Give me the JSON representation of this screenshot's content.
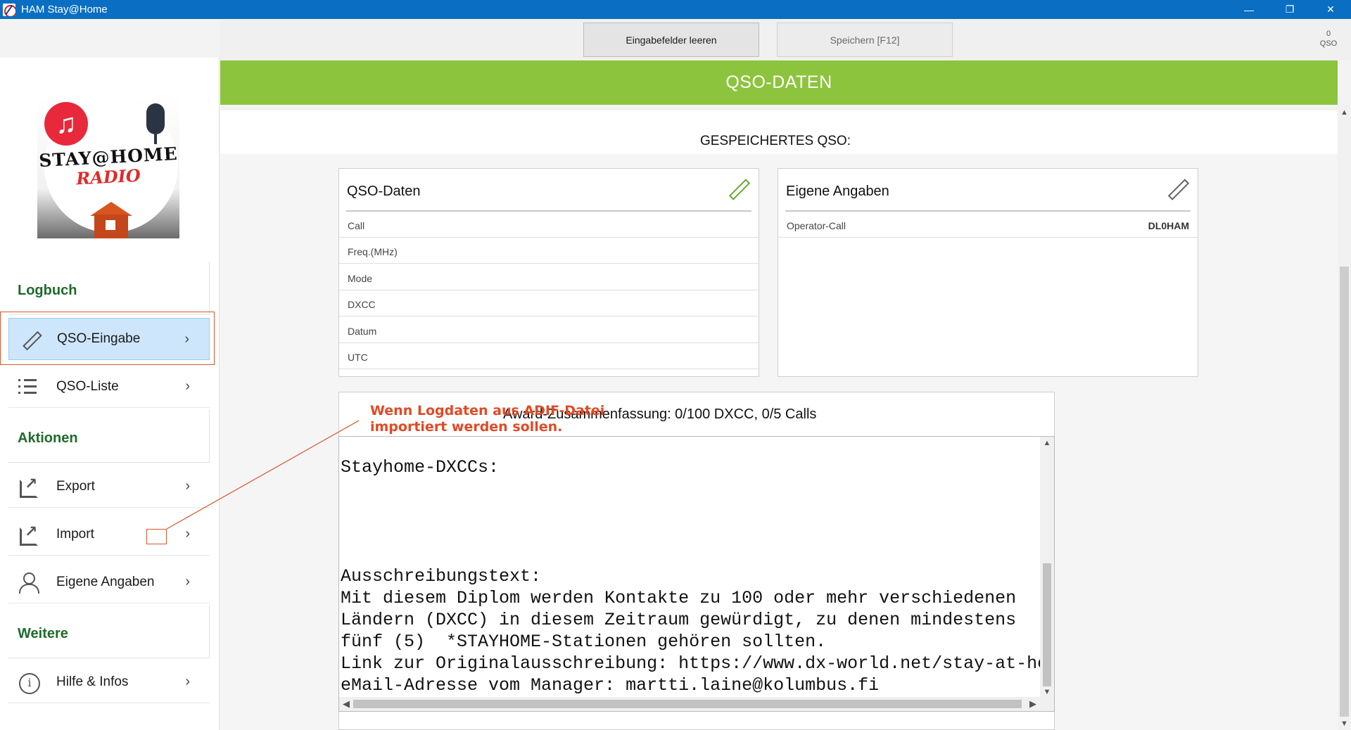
{
  "window": {
    "title": "HAM Stay@Home",
    "minimize_glyph": "—",
    "maximize_glyph": "❐",
    "close_glyph": "✕"
  },
  "logo": {
    "line1": "STAY@HOME",
    "line2": "RADIO",
    "note_glyph": "♫"
  },
  "toolbar": {
    "clear_label": "Eingabefelder leeren",
    "save_label": "Speichern [F12]",
    "qso_count": "0",
    "qso_unit": "QSO"
  },
  "header": {
    "title": "QSO-DATEN"
  },
  "sidebar": {
    "section_logbuch": "Logbuch",
    "section_aktionen": "Aktionen",
    "section_weitere": "Weitere",
    "items": [
      {
        "label": "QSO-Eingabe",
        "icon": "pencil-icon",
        "active": true
      },
      {
        "label": "QSO-Liste",
        "icon": "list-icon"
      },
      {
        "label": "Export",
        "icon": "export-icon"
      },
      {
        "label": "Import",
        "icon": "import-icon"
      },
      {
        "label": "Eigene Angaben",
        "icon": "person-icon"
      },
      {
        "label": "Hilfe & Infos",
        "icon": "info-icon"
      }
    ],
    "chevron": "›"
  },
  "main": {
    "saved_label": "GESPEICHERTES QSO:",
    "qso_card": {
      "title": "QSO-Daten",
      "rows": [
        "Call",
        "Freq.(MHz)",
        "Mode",
        "DXCC",
        "Datum",
        "UTC"
      ]
    },
    "own_card": {
      "title": "Eigene Angaben",
      "rows": [
        {
          "key": "Operator-Call",
          "value": "DL0HAM"
        }
      ]
    },
    "award_summary": "Award-Zusammenfassung: 0/100 DXCC, 0/5 Calls",
    "award_text": "Stayhome-DXCCs:\n\n\n\n\nAusschreibungstext:\nMit diesem Diplom werden Kontakte zu 100 oder mehr verschiedenen\nLändern (DXCC) in diesem Zeitraum gewürdigt, zu denen mindestens\nfünf (5)  *STAYHOME-Stationen gehören sollten.\nLink zur Originalausschreibung: https://www.dx-world.net/stay-at-home-award\neMail-Adresse vom Manager: martti.laine@kolumbus.fi"
  },
  "annotation": {
    "text": "Wenn Logdaten aus ADIF-Datei\nimportiert werden sollen.",
    "color": "#e04a25"
  },
  "colors": {
    "titlebar": "#0a6fc2",
    "header": "#8cc43e",
    "section_heading": "#1e6b2a",
    "active_item": "#cde6fb"
  }
}
